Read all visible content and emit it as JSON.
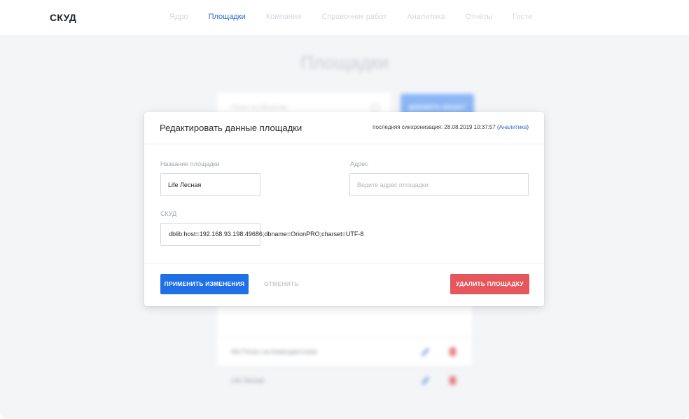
{
  "header": {
    "logo": "СКУД",
    "nav": [
      {
        "label": "Ядро",
        "active": false
      },
      {
        "label": "Площадки",
        "active": true
      },
      {
        "label": "Компании",
        "active": false
      },
      {
        "label": "Справочник работ",
        "active": false
      },
      {
        "label": "Аналитика",
        "active": false
      },
      {
        "label": "Отчёты",
        "active": false
      },
      {
        "label": "Гости",
        "active": false
      }
    ]
  },
  "background": {
    "title": "Площадки",
    "search_placeholder": "Поиск по объектам",
    "add_button": "ДОБАВИТЬ ОБЪЕКТ",
    "rows": [
      {
        "name": "ЖК Полис на Комендантском"
      },
      {
        "name": "Life Лесная"
      }
    ]
  },
  "modal": {
    "title": "Редактировать данные площадки",
    "sync_prefix": "последняя синхронизация: 28.08.2019 10:37:57 (",
    "sync_link": "Аналитика",
    "sync_suffix": ")",
    "name_label": "Название площадки",
    "name_value": "Life Лесная",
    "address_label": "Адрес",
    "address_placeholder": "Ведите адрес площадки",
    "skud_label": "СКУД",
    "skud_value": "dblib:host=192.168.93.198:49686;dbname=OrionPRO;charset=UTF-8",
    "apply_button": "ПРИМЕНИТЬ ИЗМЕНЕНИЯ",
    "cancel_button": "ОТМЕНИТЬ",
    "delete_button": "УДАЛИТЬ ПЛОЩАДКУ"
  },
  "colors": {
    "accent": "#1f6fe6",
    "nav_active": "#2c6bd7",
    "danger": "#e5575c",
    "overlay_bg": "#f4f5f7"
  },
  "icons": {
    "search": "search-icon",
    "edit": "pencil-icon",
    "delete": "trash-icon"
  }
}
